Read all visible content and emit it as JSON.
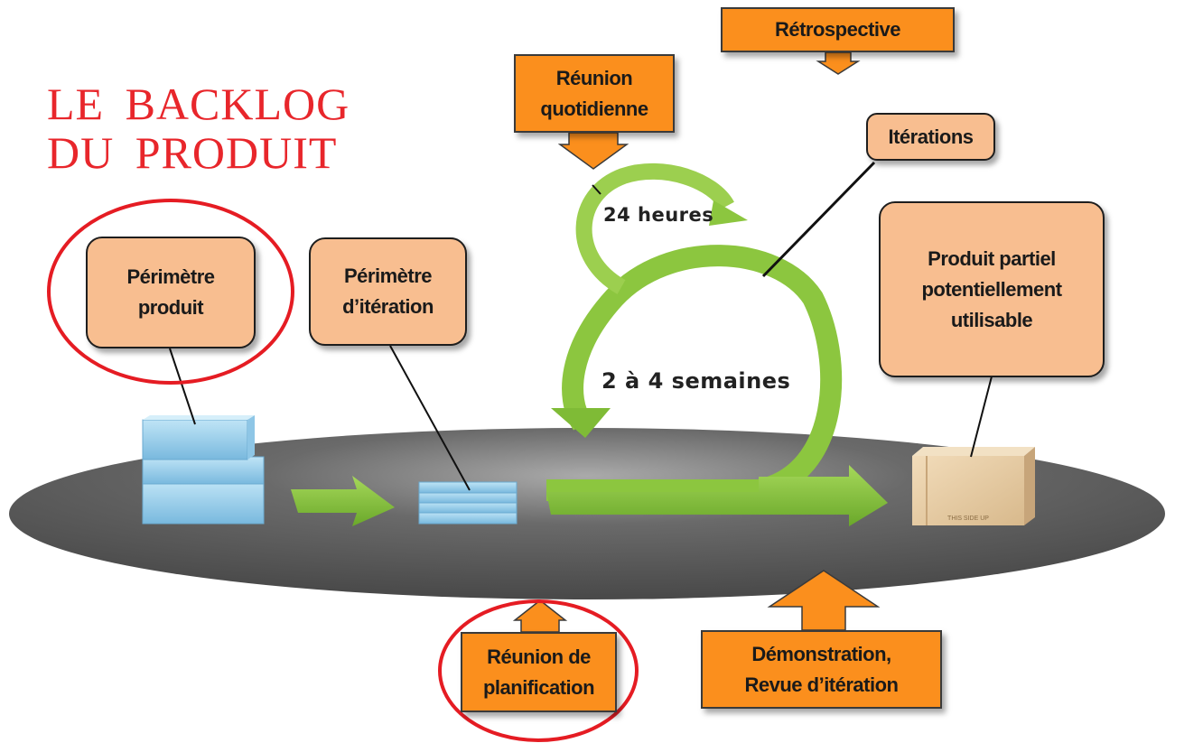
{
  "title": {
    "line1": "LE BACKLOG",
    "line2": "DU PRODUIT"
  },
  "boxes": {
    "perimetre_produit": "Périmètre\nproduit",
    "perimetre_iteration": "Périmètre\nd’itération",
    "produit_partiel": "Produit partiel\npotentiellement\nutilisable",
    "iterations": "Itérations",
    "retrospective": "Rétrospective",
    "reunion_quotidienne": "Réunion\nquotidienne",
    "reunion_planification": "Réunion de\nplanification",
    "demonstration": "Démonstration,\nRevue d’itération"
  },
  "cycle": {
    "daily": "24 heures",
    "iteration": "2 à 4 semaines"
  },
  "box_label": "THIS SIDE UP",
  "colors": {
    "title_red": "#e8262b",
    "peach": "#f8be90",
    "orange": "#fb8f1d",
    "green": "#8cc63f",
    "disc": "#5f5f5f",
    "blue": "#9fd3ee",
    "circle_red": "#e51c23"
  }
}
